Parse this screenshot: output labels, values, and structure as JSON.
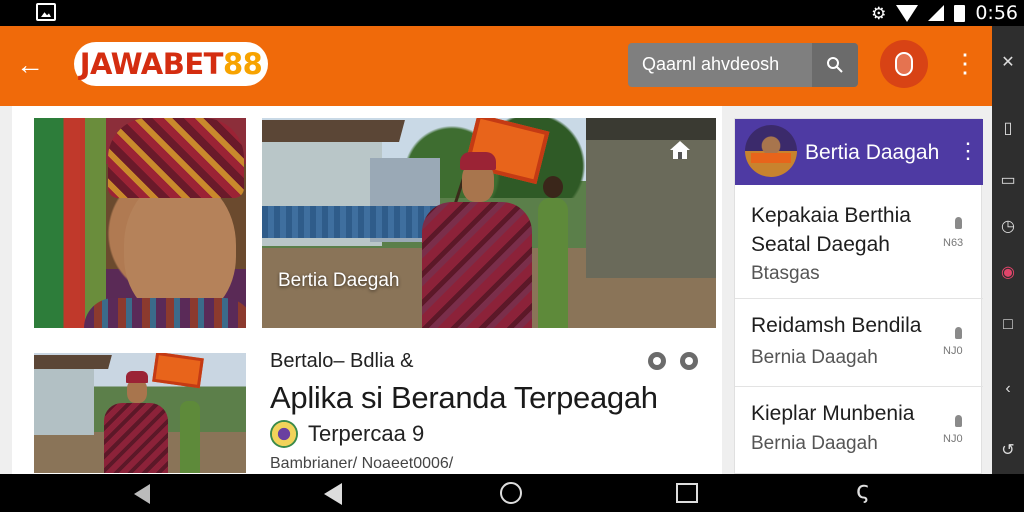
{
  "status_bar": {
    "time": "0:56"
  },
  "app_bar": {
    "logo_main": "JAWABET",
    "logo_num": "88",
    "search_text": "Qaarnl ahvdeosh"
  },
  "featured": {
    "image_caption": "Bertia Daegah"
  },
  "article": {
    "subtitle": "Bertalo– Bdlia  &",
    "title": "Aplika si Beranda Terpeagah",
    "meta": "Terpercaa  9",
    "footer": "Bambrianer/ Noaeet0006/"
  },
  "side_panel": {
    "title": "Bertia Daagah",
    "items": [
      {
        "title_line1": "Kepakaia Berthia",
        "title_line2": "Seatal Daegah",
        "sub": "Btasgas",
        "num": "N63"
      },
      {
        "title_line1": "Reidamsh Bendila",
        "title_line2": "",
        "sub": "Bernia Daagah",
        "num": "NJ0"
      },
      {
        "title_line1": "Kieplar Munbenia",
        "title_line2": "",
        "sub": "Bernia Daagah",
        "num": "NJ0"
      }
    ]
  },
  "colors": {
    "appbar": "#f06a0a",
    "panel_header": "#4e3aa3",
    "logo_text": "#d42d10",
    "logo_num": "#f7a300"
  },
  "icons": [
    "back-arrow-icon",
    "search-icon",
    "avatar-icon",
    "more-vert-icon",
    "home-icon",
    "bookmark-icon",
    "share-icon"
  ]
}
